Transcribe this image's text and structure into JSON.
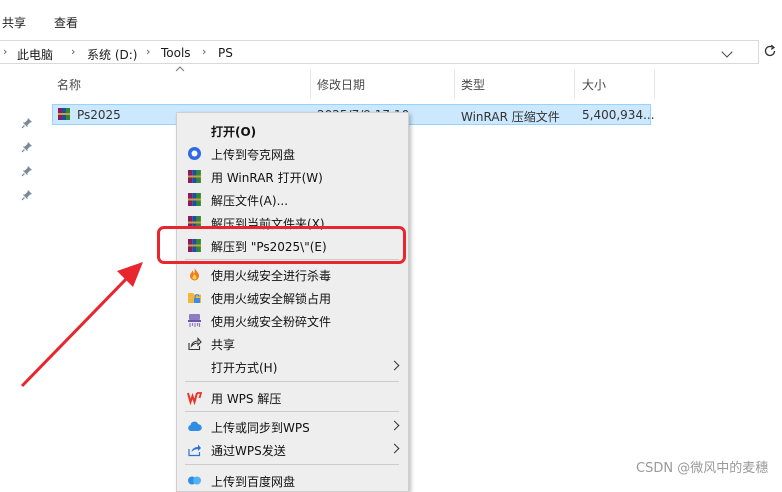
{
  "ribbon": {
    "tabs": [
      "共享",
      "查看"
    ]
  },
  "address_bar": {
    "crumbs": [
      "此电脑",
      "系统 (D:)",
      "Tools",
      "PS"
    ]
  },
  "columns": [
    "名称",
    "修改日期",
    "类型",
    "大小"
  ],
  "file": {
    "name": "Ps2025",
    "modified": "2025/7/9 17:10",
    "type": "WinRAR 压缩文件",
    "size": "5,400,934..."
  },
  "context_menu": {
    "items": [
      {
        "label": "打开(O)",
        "icon": "none",
        "bold": true
      },
      {
        "label": "上传到夸克网盘",
        "icon": "quark-icon"
      },
      {
        "label": "用 WinRAR 打开(W)",
        "icon": "winrar-icon"
      },
      {
        "label": "解压文件(A)...",
        "icon": "winrar-icon"
      },
      {
        "label": "解压到当前文件夹(X)",
        "icon": "winrar-icon"
      },
      {
        "label": "解压到 \"Ps2025\\\"(E)",
        "icon": "winrar-icon"
      },
      {
        "label": "使用火绒安全进行杀毒",
        "icon": "huorong-icon"
      },
      {
        "label": "使用火绒安全解锁占用",
        "icon": "unlock-folder-icon"
      },
      {
        "label": "使用火绒安全粉碎文件",
        "icon": "shredder-icon"
      },
      {
        "label": "共享",
        "icon": "share-icon"
      },
      {
        "label": "打开方式(H)",
        "icon": "none",
        "submenu": true
      },
      {
        "label": "用 WPS 解压",
        "icon": "wps-icon"
      },
      {
        "label": "上传或同步到WPS",
        "icon": "wps-cloud-icon",
        "submenu": true
      },
      {
        "label": "通过WPS发送",
        "icon": "wps-send-icon",
        "submenu": true
      },
      {
        "label": "上传到百度网盘",
        "icon": "baidu-icon"
      }
    ]
  },
  "watermark": "CSDN @微风中的麦穗",
  "colors": {
    "selection_bg": "#cce8ff",
    "selection_border": "#99d1ff",
    "menu_bg": "#eeeeee",
    "highlight_red": "#e8262d"
  }
}
